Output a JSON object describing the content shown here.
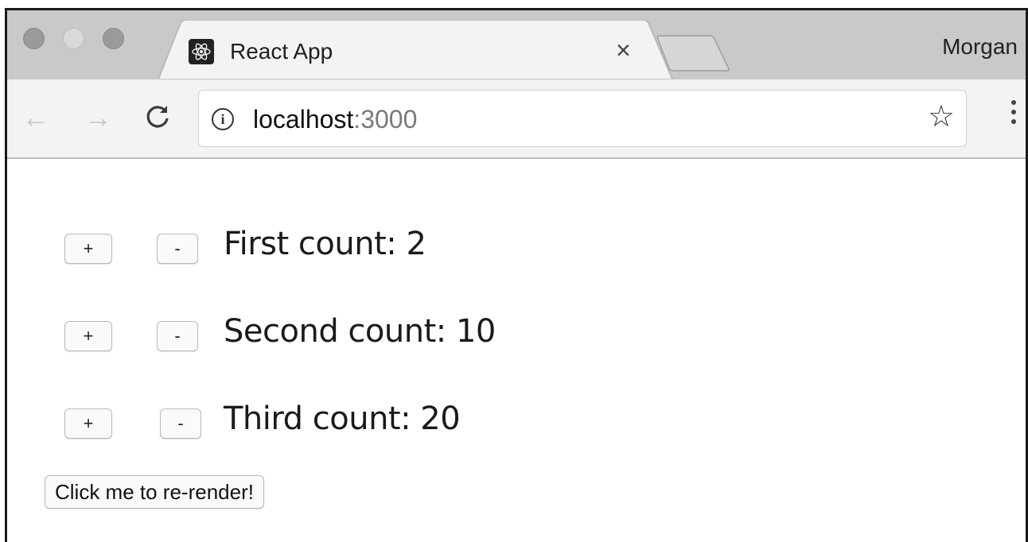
{
  "browser": {
    "tab": {
      "title": "React App",
      "close_glyph": "×",
      "favicon": "react-logo-icon"
    },
    "profile_name": "Morgan",
    "toolbar": {
      "back_glyph": "←",
      "forward_glyph": "→",
      "reload_glyph": "C",
      "url_host": "localhost",
      "url_port": ":3000",
      "info_glyph": "i",
      "bookmark_glyph": "☆"
    }
  },
  "counters": [
    {
      "plus_label": "+",
      "minus_label": "-",
      "text": "First count: 2"
    },
    {
      "plus_label": "+",
      "minus_label": "-",
      "text": "Second count: 10"
    },
    {
      "plus_label": "+",
      "minus_label": "-",
      "text": "Third count: 20"
    }
  ],
  "rerender_button_label": "Click me to re-render!",
  "colors": {
    "tabstrip": "#c9c9c9",
    "toolbar": "#f3f3f3",
    "page_background": "#ffffff"
  }
}
